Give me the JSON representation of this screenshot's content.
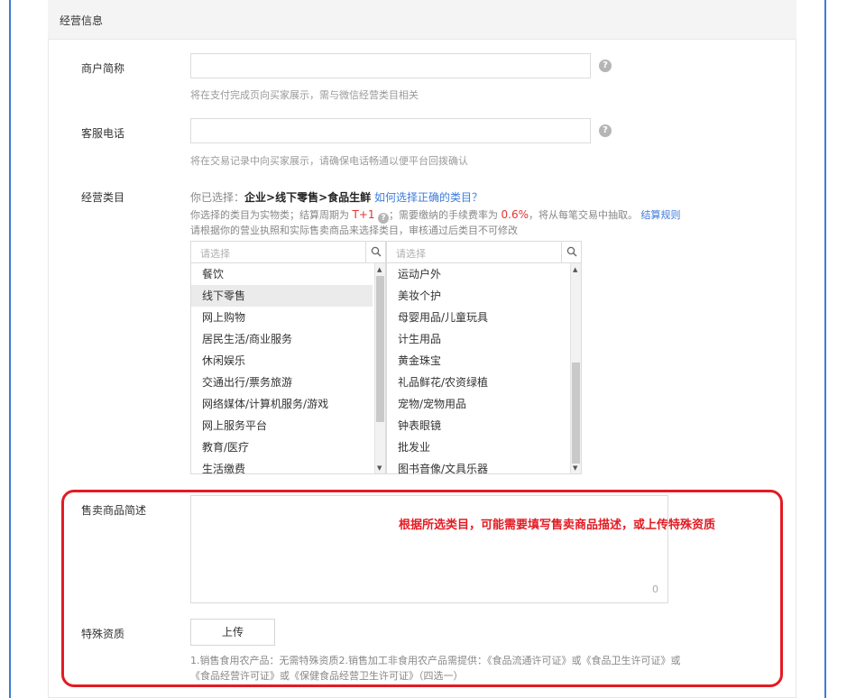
{
  "section": {
    "title": "经营信息"
  },
  "merchant_name": {
    "label": "商户简称",
    "value": "",
    "hint": "将在支付完成页向买家展示，需与微信经营类目相关"
  },
  "service_phone": {
    "label": "客服电话",
    "value": "",
    "hint": "将在交易记录中向买家展示，请确保电话畅通以便平台回拨确认"
  },
  "category": {
    "label": "经营类目",
    "selected_prefix": "你已选择：",
    "selected_path": "企业>线下零售>食品生鲜",
    "how_to_link": "如何选择正确的类目？",
    "info_part1": "你选择的类目为实物类；结算周期为",
    "settle_cycle": "T+1",
    "info_part2": "；需要缴纳的手续费率为",
    "fee_rate": "0.6%",
    "info_part3": "，将从每笔交易中抽取。",
    "rules_link": "结算规则",
    "advice": "请根据你的营业执照和实际售卖商品来选择类目，审核通过后类目不可修改",
    "left_panel": {
      "placeholder": "请选择",
      "items": [
        "餐饮",
        "线下零售",
        "网上购物",
        "居民生活/商业服务",
        "休闲娱乐",
        "交通出行/票务旅游",
        "网络媒体/计算机服务/游戏",
        "网上服务平台",
        "教育/医疗",
        "生活缴费"
      ],
      "selected_index": 1
    },
    "right_panel": {
      "placeholder": "请选择",
      "items": [
        "运动户外",
        "美妆个护",
        "母婴用品/儿童玩具",
        "计生用品",
        "黄金珠宝",
        "礼品鲜花/农资绿植",
        "宠物/宠物用品",
        "钟表眼镜",
        "批发业",
        "图书音像/文具乐器"
      ]
    }
  },
  "product_desc": {
    "label": "售卖商品简述",
    "value": "",
    "counter": "0"
  },
  "annotation": {
    "text": "根据所选类目，可能需要填写售卖商品描述，或上传特殊资质",
    "color": "#e31b23"
  },
  "special_qualification": {
    "label": "特殊资质",
    "upload_label": "上传",
    "note_line1": "1.销售食用农产品：无需特殊资质2.销售加工非食用农产品需提供：《食品流通许可证》或《食品卫生许可证》或",
    "note_line2": "《食品经营许可证》或《保健食品经营卫生许可证》（四选一）"
  },
  "colors": {
    "accent": "#3d7bd9",
    "highlight": "#e53333"
  }
}
